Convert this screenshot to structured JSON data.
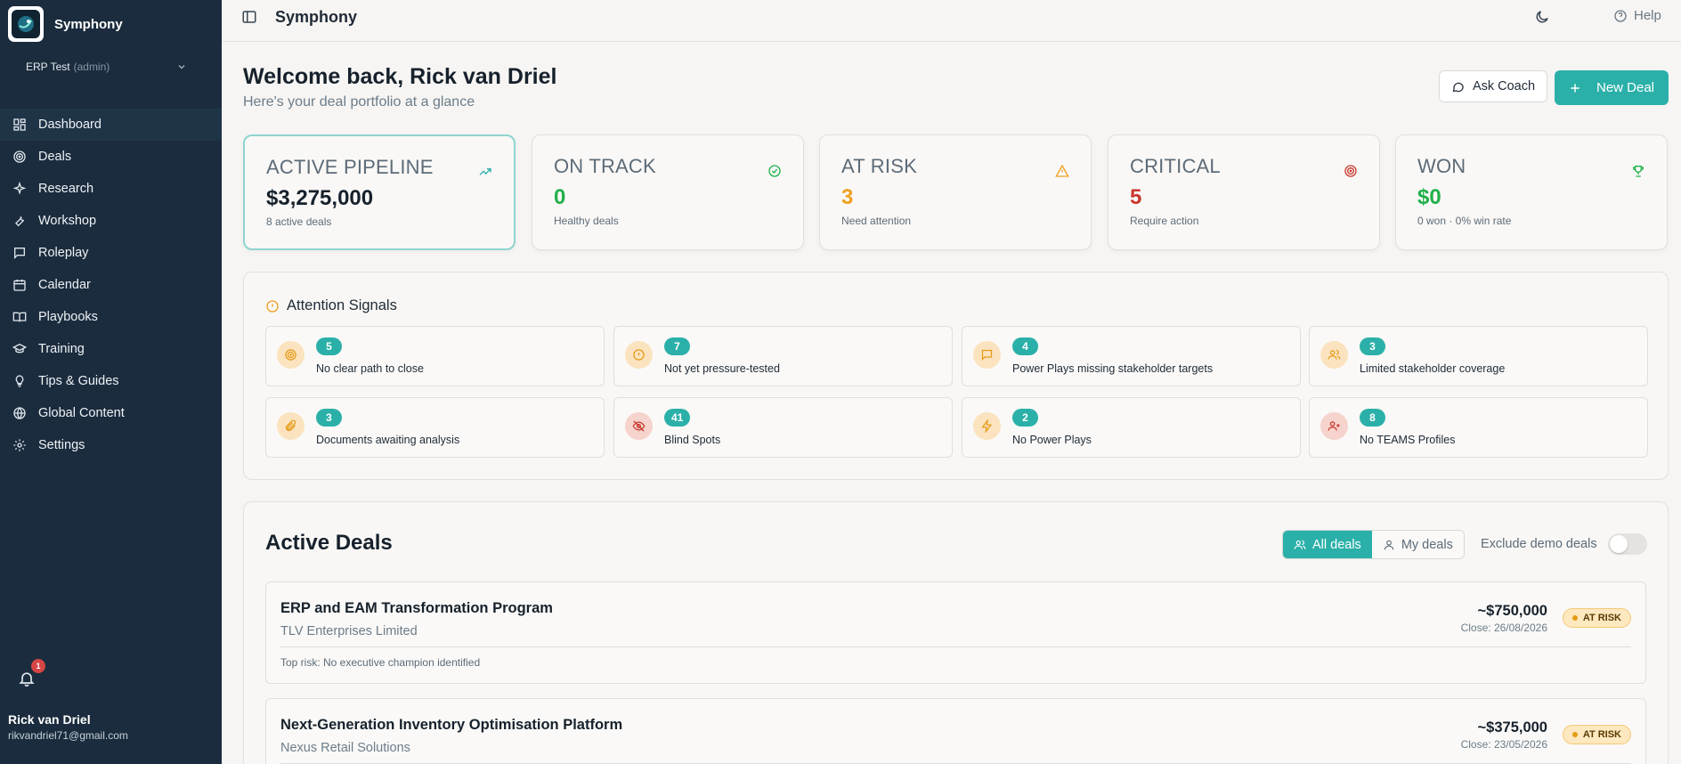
{
  "app": {
    "name": "Symphony"
  },
  "org": {
    "name": "ERP Test",
    "role": "(admin)"
  },
  "nav": [
    {
      "label": "Dashboard",
      "icon": "layout-grid-icon",
      "active": true
    },
    {
      "label": "Deals",
      "icon": "target-icon"
    },
    {
      "label": "Research",
      "icon": "sparkles-icon"
    },
    {
      "label": "Workshop",
      "icon": "wrench-icon"
    },
    {
      "label": "Roleplay",
      "icon": "message-square-icon"
    },
    {
      "label": "Calendar",
      "icon": "calendar-icon"
    },
    {
      "label": "Playbooks",
      "icon": "book-open-icon"
    },
    {
      "label": "Training",
      "icon": "graduation-cap-icon"
    },
    {
      "label": "Tips & Guides",
      "icon": "lightbulb-icon"
    },
    {
      "label": "Global Content",
      "icon": "globe-icon"
    },
    {
      "label": "Settings",
      "icon": "gear-icon"
    }
  ],
  "notifications": {
    "count": "1"
  },
  "user": {
    "name": "Rick van Driel",
    "email": "rikvandriel71@gmail.com"
  },
  "topbar": {
    "title": "Symphony",
    "help_label": "Help"
  },
  "header": {
    "welcome": "Welcome back, Rick van Driel",
    "subtitle": "Here's your deal portfolio at a glance",
    "ask_coach_label": "Ask Coach",
    "new_deal_label": "New Deal"
  },
  "stats": [
    {
      "label": "ACTIVE PIPELINE",
      "value": "$3,275,000",
      "sub": "8 active deals",
      "color": "#16212c",
      "icon": "trending-up-icon"
    },
    {
      "label": "ON TRACK",
      "value": "0",
      "sub": "Healthy deals",
      "color": "#22b04a",
      "icon": "check-circle-icon"
    },
    {
      "label": "AT RISK",
      "value": "3",
      "sub": "Need attention",
      "color": "#f0a021",
      "icon": "alert-triangle-icon"
    },
    {
      "label": "CRITICAL",
      "value": "5",
      "sub": "Require action",
      "color": "#c8372d",
      "icon": "target-icon"
    },
    {
      "label": "WON",
      "value": "$0",
      "sub": "0 won · 0% win rate",
      "color": "#22b04a",
      "icon": "trophy-icon"
    }
  ],
  "signals": {
    "title": "Attention Signals",
    "items": [
      {
        "count": "5",
        "label": "No clear path to close",
        "icon": "target-icon",
        "tone": "amber"
      },
      {
        "count": "7",
        "label": "Not yet pressure-tested",
        "icon": "alert-circle-icon",
        "tone": "amber"
      },
      {
        "count": "4",
        "label": "Power Plays missing stakeholder targets",
        "icon": "message-square-icon",
        "tone": "amber"
      },
      {
        "count": "3",
        "label": "Limited stakeholder coverage",
        "icon": "users-icon",
        "tone": "amber"
      },
      {
        "count": "3",
        "label": "Documents awaiting analysis",
        "icon": "paperclip-icon",
        "tone": "amber"
      },
      {
        "count": "41",
        "label": "Blind Spots",
        "icon": "eye-off-icon",
        "tone": "red"
      },
      {
        "count": "2",
        "label": "No Power Plays",
        "icon": "zap-icon",
        "tone": "amber"
      },
      {
        "count": "8",
        "label": "No TEAMS Profiles",
        "icon": "user-x-icon",
        "tone": "red"
      }
    ]
  },
  "deals": {
    "title": "Active Deals",
    "filters": {
      "all_label": "All deals",
      "mine_label": "My deals"
    },
    "exclude_label": "Exclude demo deals",
    "items": [
      {
        "name": "ERP and EAM Transformation Program",
        "company": "TLV Enterprises Limited",
        "amount": "~$750,000",
        "close": "Close: 26/08/2026",
        "status": "AT RISK",
        "top_risk": "Top risk: No executive champion identified"
      },
      {
        "name": "Next-Generation Inventory Optimisation Platform",
        "company": "Nexus Retail Solutions",
        "amount": "~$375,000",
        "close": "Close: 23/05/2026",
        "status": "AT RISK",
        "top_risk": ""
      }
    ]
  },
  "colors": {
    "sidebar": "#1b2c3e",
    "accent": "#2bb0a9",
    "warning": "#f0a021",
    "danger": "#c8372d",
    "success": "#22b04a"
  }
}
